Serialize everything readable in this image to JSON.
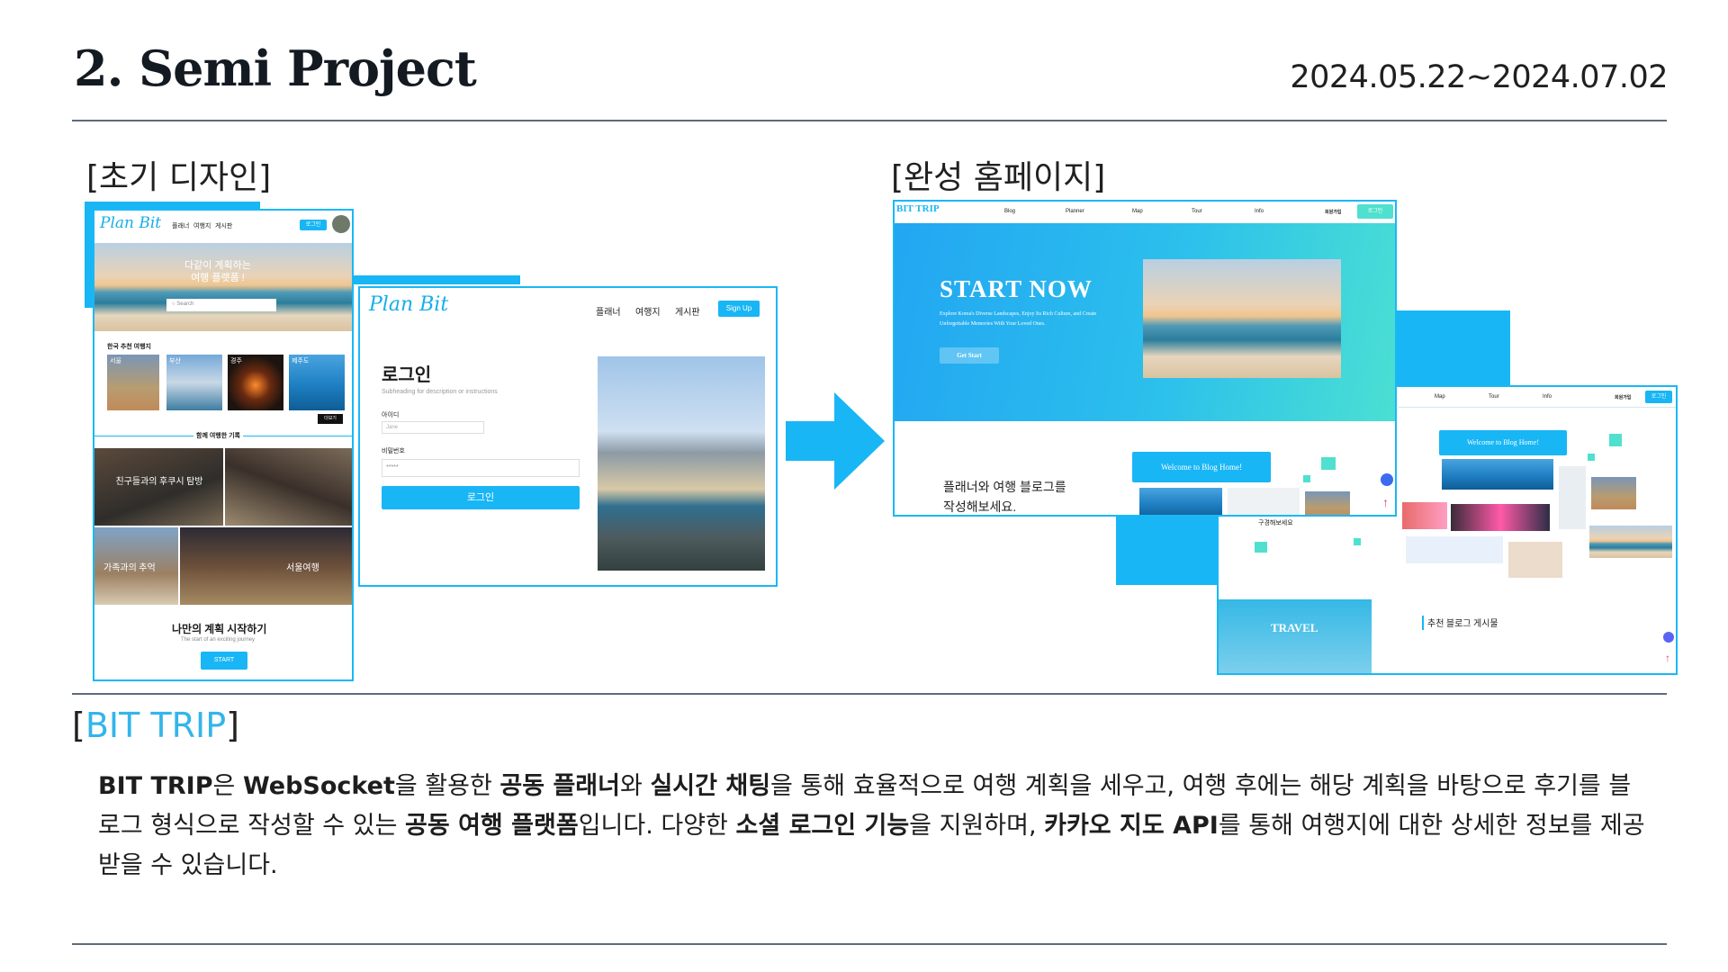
{
  "header": {
    "title": "2. Semi Project",
    "date_range": "2024.05.22~2024.07.02"
  },
  "sections": {
    "initial_design": "[초기 디자인]",
    "final_site": "[완성 홈페이지]"
  },
  "mock_initial_home": {
    "logo": "Plan Bit",
    "nav": [
      "플래너",
      "여행지",
      "게시판"
    ],
    "login_btn": "로그인",
    "hero_text_1": "다같이 계획하는",
    "hero_text_2": "여행 플랫폼 !",
    "search_placeholder": "Search",
    "recommend_title": "한국 추천 여행지",
    "cities": [
      "서울",
      "부산",
      "경주",
      "제주도"
    ],
    "more_btn": "더보기",
    "together_title": "함께 여행한 기록",
    "story_1": "친구들과의 후쿠시 탐방",
    "story_2": "가족과의 추억",
    "story_3": "서울여행",
    "plan_title": "나만의 계획 시작하기",
    "plan_sub": "The start of an exciting journey",
    "start_btn": "START"
  },
  "mock_initial_login": {
    "logo": "Plan Bit",
    "nav": [
      "플래너",
      "여행지",
      "게시판"
    ],
    "signup_btn": "Sign Up",
    "heading": "로그인",
    "subheading": "Subheading for description or instructions",
    "id_label": "아이디",
    "id_value": "Jane",
    "pw_label": "비밀번호",
    "pw_value": "*****",
    "submit": "로그인"
  },
  "mock_final_home": {
    "logo": "BIT TRIP",
    "nav": [
      "Blog",
      "Planner",
      "Map",
      "Tour",
      "Info"
    ],
    "join": "회원가입",
    "login": "로그인",
    "hero_title": "START NOW",
    "hero_sub": "Explore Korea's Diverse Landscapes, Enjoy Its Rich Culture, and Create Unforgettable Memories With Your Loved Ones.",
    "hero_btn": "Get Start",
    "blog_text_1": "플래너와 여행 블로그를",
    "blog_text_2": "작성해보세요.",
    "welcome": "Welcome to Blog Home!"
  },
  "mock_final_back": {
    "nav": [
      "Map",
      "Tour",
      "Info"
    ],
    "join": "회원가입",
    "login": "로그인",
    "welcome": "Welcome to Blog Home!",
    "caption": "구경해보세요",
    "travel": "TRAVEL",
    "recommend_board": "추천 블로그 게시물"
  },
  "project": {
    "label_open": "[",
    "label_name": "BIT TRIP",
    "label_close": "]",
    "description": {
      "t1": "BIT TRIP",
      "t2": "은 ",
      "t3": "WebSocket",
      "t4": "을 활용한 ",
      "t5": "공동 플래너",
      "t6": "와 ",
      "t7": "실시간 채팅",
      "t8": "을 통해 효율적으로 여행 계획을 세우고, 여행 후에는 해당 계획을 바탕으로 후기를 블로그 형식으로 작성할 수 있는 ",
      "t9": "공동 여행 플랫폼",
      "t10": "입니다. 다양한 ",
      "t11": "소셜 로그인 기능",
      "t12": "을 지원하며, ",
      "t13": "카카오 지도 API",
      "t14": "를 통해 여행지에 대한 상세한 정보를 제공받을 수 있습니다."
    }
  },
  "colors": {
    "accent": "#18b6f5",
    "rule": "#5d6b7a",
    "title": "#141a22"
  }
}
